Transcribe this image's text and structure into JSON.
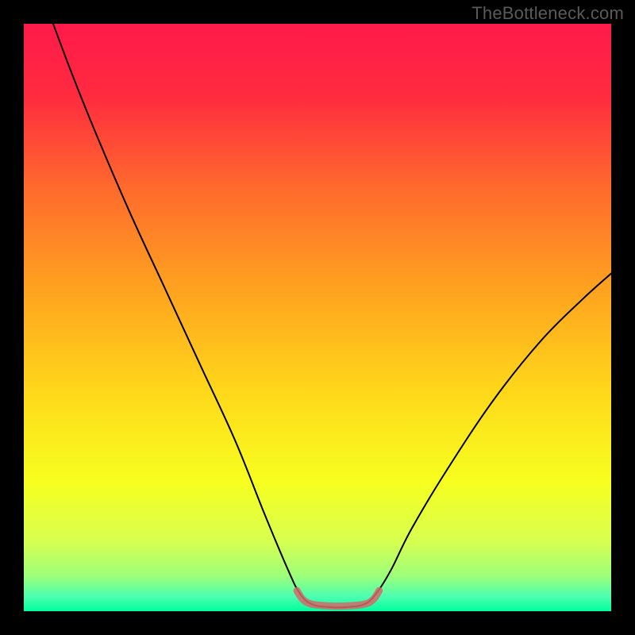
{
  "watermark": "TheBottleneck.com",
  "chart_data": {
    "type": "line",
    "title": "",
    "xlabel": "",
    "ylabel": "",
    "xlim": [
      0,
      100
    ],
    "ylim": [
      0,
      100
    ],
    "gradient_stops": [
      {
        "offset": 0.0,
        "color": "#ff1a4b"
      },
      {
        "offset": 0.12,
        "color": "#ff2a3f"
      },
      {
        "offset": 0.28,
        "color": "#ff6a2d"
      },
      {
        "offset": 0.45,
        "color": "#ffa21f"
      },
      {
        "offset": 0.62,
        "color": "#ffd61a"
      },
      {
        "offset": 0.78,
        "color": "#f7ff1f"
      },
      {
        "offset": 0.88,
        "color": "#d8ff4f"
      },
      {
        "offset": 0.94,
        "color": "#9dff7a"
      },
      {
        "offset": 0.975,
        "color": "#4dffb0"
      },
      {
        "offset": 1.0,
        "color": "#00ff9d"
      }
    ],
    "series": [
      {
        "name": "bottleneck-curve-main",
        "color": "#000000",
        "width": 2.0,
        "points": [
          {
            "x": 5.0,
            "y": 100.0
          },
          {
            "x": 8.0,
            "y": 92.0
          },
          {
            "x": 12.0,
            "y": 82.0
          },
          {
            "x": 18.0,
            "y": 68.0
          },
          {
            "x": 24.0,
            "y": 55.0
          },
          {
            "x": 30.0,
            "y": 42.0
          },
          {
            "x": 36.0,
            "y": 29.0
          },
          {
            "x": 41.0,
            "y": 16.5
          },
          {
            "x": 45.0,
            "y": 7.0
          },
          {
            "x": 47.0,
            "y": 3.0
          },
          {
            "x": 49.0,
            "y": 1.2
          },
          {
            "x": 52.0,
            "y": 0.7
          },
          {
            "x": 55.0,
            "y": 0.7
          },
          {
            "x": 58.0,
            "y": 1.2
          },
          {
            "x": 60.0,
            "y": 3.0
          },
          {
            "x": 62.5,
            "y": 7.0
          },
          {
            "x": 66.0,
            "y": 14.0
          },
          {
            "x": 72.0,
            "y": 24.0
          },
          {
            "x": 80.0,
            "y": 36.0
          },
          {
            "x": 88.0,
            "y": 46.0
          },
          {
            "x": 95.0,
            "y": 53.0
          },
          {
            "x": 100.0,
            "y": 57.5
          }
        ]
      },
      {
        "name": "flat-bottom-marker",
        "color": "#d46a6a",
        "width": 9,
        "opacity": 0.85,
        "points": [
          {
            "x": 46.5,
            "y": 3.5
          },
          {
            "x": 47.5,
            "y": 2.0
          },
          {
            "x": 49.0,
            "y": 1.2
          },
          {
            "x": 52.0,
            "y": 0.9
          },
          {
            "x": 55.0,
            "y": 0.9
          },
          {
            "x": 58.0,
            "y": 1.2
          },
          {
            "x": 59.5,
            "y": 2.0
          },
          {
            "x": 60.5,
            "y": 3.5
          }
        ]
      }
    ]
  }
}
